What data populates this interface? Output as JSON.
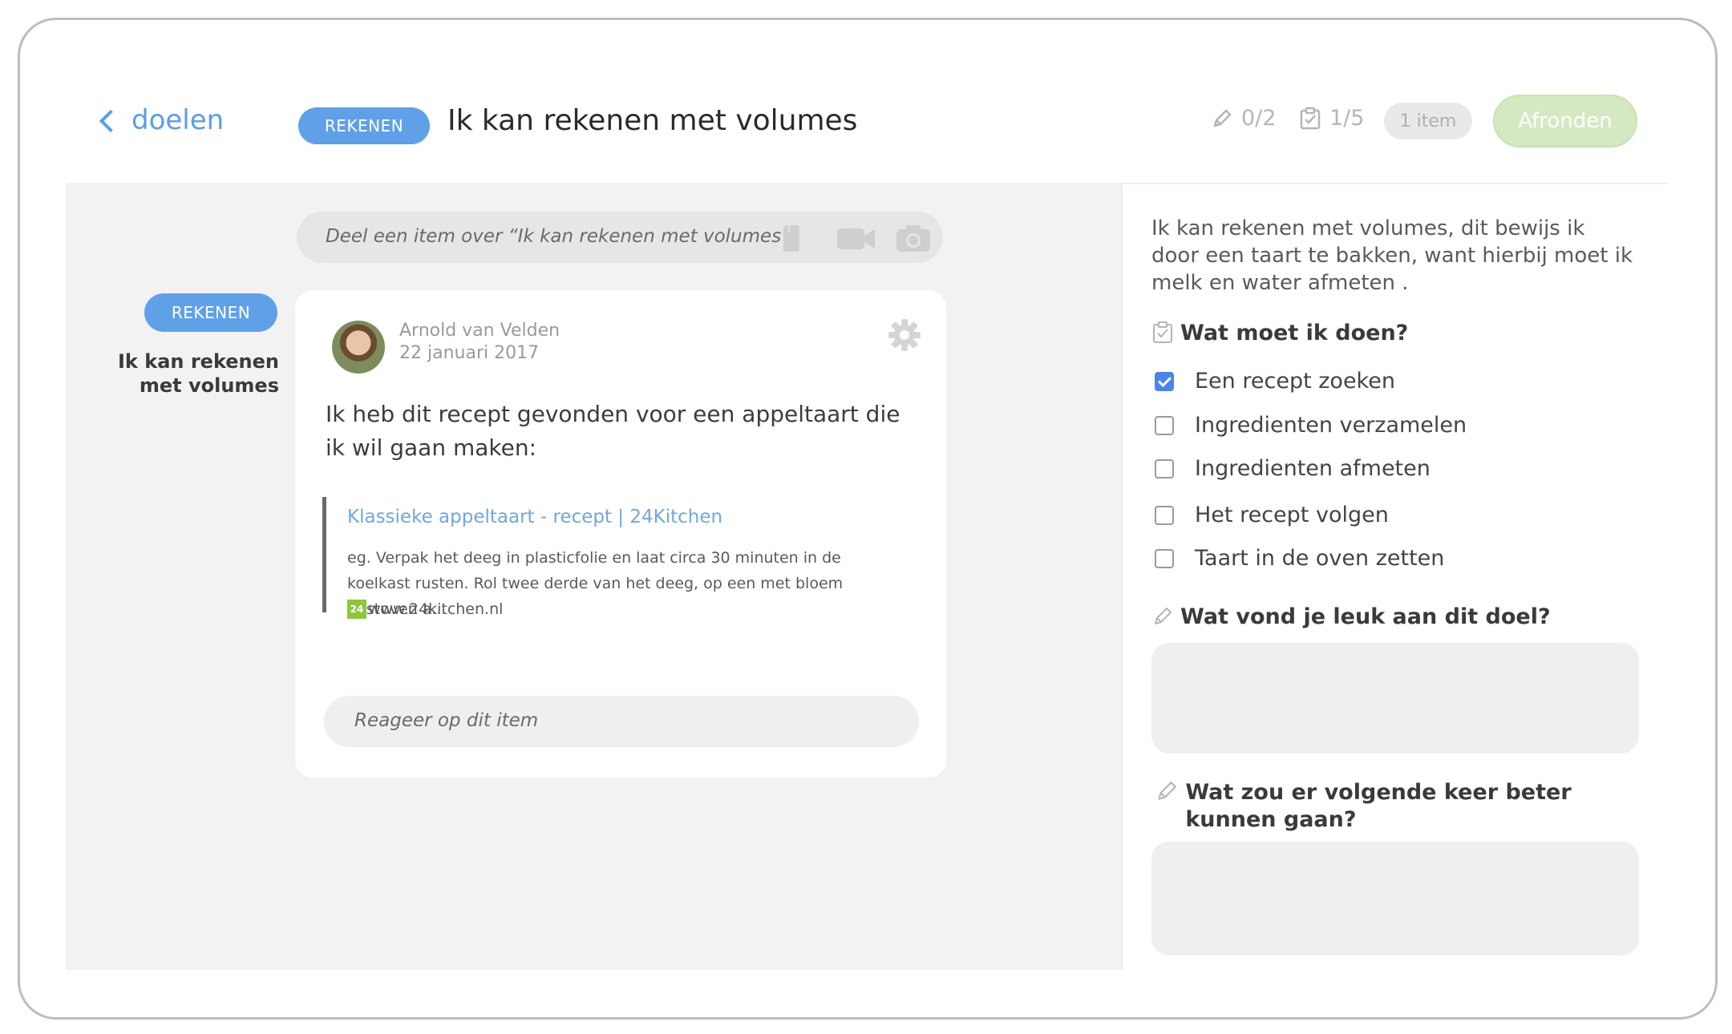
{
  "header": {
    "back_label": "doelen",
    "subject_tag": "REKENEN",
    "goal_title": "Ik kan rekenen met volumes",
    "reflections_count": "0/2",
    "tasks_count": "1/5",
    "items_count": "1 item",
    "finish_button": "Afronden"
  },
  "share": {
    "placeholder": "Deel een item over “Ik kan rekenen met volumes”",
    "icons": [
      "attachment-icon",
      "video-camera-icon",
      "photo-camera-icon"
    ]
  },
  "sidebar": {
    "tag": "REKENEN",
    "goal": "Ik kan rekenen met volumes"
  },
  "post": {
    "author": "Arnold van Velden",
    "date": "22 januari 2017",
    "text": "Ik heb dit recept gevonden voor een appeltaart die ik wil gaan maken:",
    "link": {
      "title": "Klassieke appeltaart - recept | 24Kitchen",
      "description": "eg. Verpak het deeg in plasticfolie en laat circa 30 minuten in de koelkast rusten. Rol twee derde van het deeg, op een met bloem bestoven a...",
      "source": "www.24kitchen.nl",
      "favicon_text": "24"
    },
    "reply_placeholder": "Reageer op dit item"
  },
  "details": {
    "description": "Ik kan rekenen met volumes, dit bewijs ik door een taart te bakken, want hierbij moet ik melk en water afmeten .",
    "todo_title": "Wat moet ik doen?",
    "todos": [
      {
        "label": "Een recept zoeken",
        "checked": true
      },
      {
        "label": "Ingredienten verzamelen",
        "checked": false
      },
      {
        "label": "Ingredienten afmeten",
        "checked": false
      },
      {
        "label": "Het recept volgen",
        "checked": false
      },
      {
        "label": "Taart in de oven zetten",
        "checked": false
      }
    ],
    "question_like": "Wat vond je leuk aan dit doel?",
    "question_better": "Wat zou er volgende keer beter kunnen gaan?"
  },
  "colors": {
    "accent": "#5fa0e8",
    "link": "#6fa8dc",
    "finish_bg": "#d4e9c2",
    "panel_bg": "#f2f2f2",
    "checkbox_checked": "#4a86e8"
  }
}
